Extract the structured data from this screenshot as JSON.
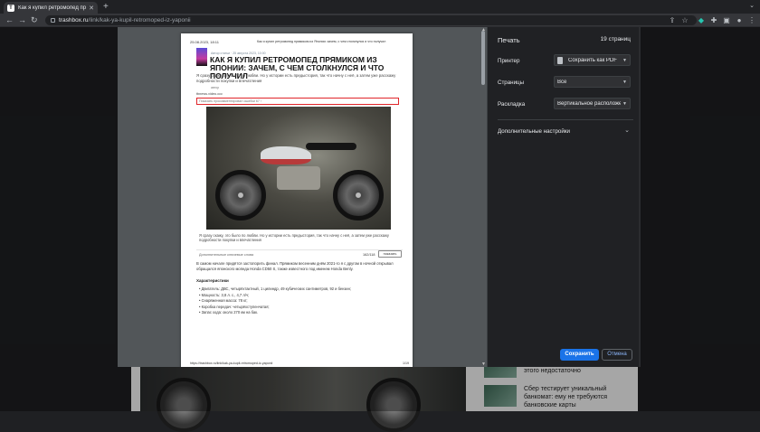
{
  "browser": {
    "tab_title": "Как я купил ретромопед прямико",
    "favicon_letter": "T",
    "new_tab": "+",
    "url_host": "trashbox.ru",
    "url_path": "/link/kak-ya-kupil-retromoped-iz-yaponii"
  },
  "print_preview": {
    "date": "25.08.2023, 18:11",
    "header": "Как я купил ретромопед прямиком из Японии: зачем, с чем столкнулся и что получил",
    "meta": "Автор статьи · 25 августа 2023, 10:00",
    "title": "Как я купил ретромопед прямиком из Японии: зачем, с чем столкнулся и что получил",
    "lead": "Я сразу скажу, это было по любви. Но у истории есть предыстория, так что начну с неё, а затем уже расскажу подробности покупки и впечатления",
    "avatar_name": "автор",
    "source": "tbnews.video.ссс",
    "comments": "Показать прокомментировал ошибки 67 ›",
    "caption": "Я сразу скажу, это было по любви. Но у истории есть предыстория, так что начну с неё, а затем уже расскажу подробности покупки и впечатления",
    "extra_label": "Дополнительные ключевые слова",
    "count": "162/118",
    "show_button": "показать",
    "body": "В самом начале придётся застопорить финал. Прямиком весенним днём 2021-го я с другом в ночной открывал обращался японского мопеда Honda CD50 S, также известного под именем Honda Benly.",
    "specs_title": "Характеристики",
    "specs": [
      "Двигатель: ДВС, четырёхтактный, 1 цилиндр, 49 кубических сантиметров, 92 и бензин;",
      "Мощность: 3,8 л. с., 4,7 л/ч;",
      "Снаряженная масса: 78 кг;",
      "Коробка передач: четырёхступенчатая;",
      "Запас хода: около 270 км на бак."
    ],
    "footer_url": "https://trashbox.ru/link/kak-ya-kupil-retromoped-iz-yaponii",
    "footer_page": "1/19"
  },
  "print_settings": {
    "title": "Печать",
    "pages_count": "19 страниц",
    "printer_label": "Принтер",
    "printer_value": "Сохранить как PDF",
    "pages_label": "Страницы",
    "pages_value": "Все",
    "layout_label": "Раскладка",
    "layout_value": "Вертикальное расположение",
    "more_settings": "Дополнительные настройки",
    "save_button": "Сохранить",
    "cancel_button": "Отмена"
  },
  "background_page": {
    "sidebar_item_1": "этого недостаточно",
    "sidebar_item_2": "Сбер тестирует уникальный банкомат: ему не требуются банковские карты"
  },
  "colors": {
    "accent": "#1a73e8",
    "dialog_bg": "#202124",
    "preview_bg": "#525659",
    "outline_red": "#e0252a"
  }
}
